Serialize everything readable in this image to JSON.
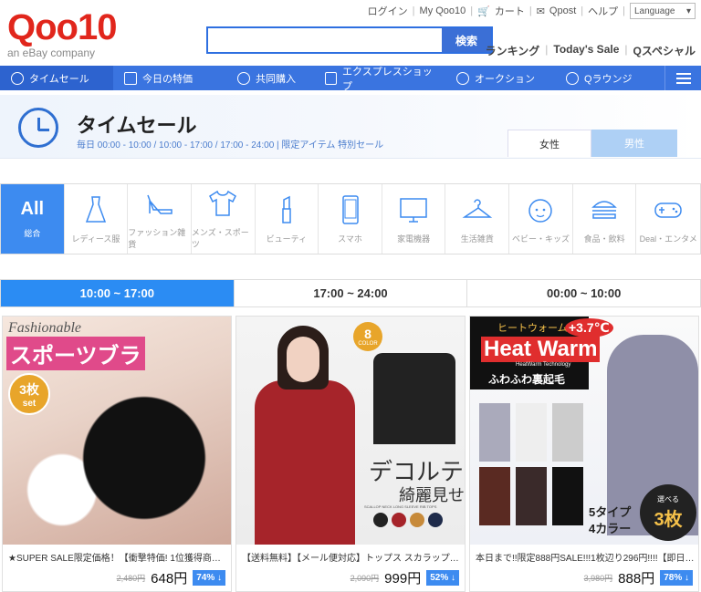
{
  "header": {
    "logo_brand": "Qoo10",
    "logo_sub": "an eBay company",
    "util_links": [
      "ログイン",
      "My Qoo10",
      "カート",
      "Qpost",
      "ヘルプ"
    ],
    "language": "Language",
    "search": {
      "placeholder": "",
      "button": "検索"
    },
    "right_links": [
      "ランキング",
      "Today's Sale",
      "Qスペシャル"
    ]
  },
  "nav": {
    "items": [
      "タイムセール",
      "今日の特価",
      "共同購入",
      "エクスプレスショップ",
      "オークション",
      "Qラウンジ"
    ]
  },
  "hero": {
    "title": "タイムセール",
    "desc": "毎日 00:00 - 10:00 / 10:00 - 17:00 / 17:00 - 24:00 | 限定アイテム 特別セール",
    "gender_tabs": [
      "女性",
      "男性"
    ]
  },
  "categories": [
    {
      "big": "All",
      "label": "総合"
    },
    {
      "label": "レディース服"
    },
    {
      "label": "ファッション雑貨"
    },
    {
      "label": "メンズ・スポーツ"
    },
    {
      "label": "ビューティ"
    },
    {
      "label": "スマホ"
    },
    {
      "label": "家電機器"
    },
    {
      "label": "生活雑貨"
    },
    {
      "label": "ベビー・キッズ"
    },
    {
      "label": "食品・飲料"
    },
    {
      "label": "Deal・エンタメ"
    }
  ],
  "time_tabs": [
    "10:00 ~ 17:00",
    "17:00 ~ 24:00",
    "00:00 ~ 10:00"
  ],
  "products": [
    {
      "name": "★SUPER SALE限定価格！【衝撃特価! 1位獲得商品】...",
      "old_price": "2,480円",
      "price": "648円",
      "discount": "74% ↓",
      "img_text": [
        "Fashionable",
        "スポーツブラ",
        "3枚",
        "set"
      ]
    },
    {
      "name": "【送料無料】【メール便対応】トップス スカラップ リブ 長袖...",
      "old_price": "2,090円",
      "price": "999円",
      "discount": "52% ↓",
      "img_text": [
        "8",
        "COLOR",
        "デコルテ",
        "綺麗見せ",
        "SCALLOP NECK LONG SLEEVE RIB TOPS"
      ]
    },
    {
      "name": "本日まで!!限定888円SALE!!!1枚辺り296円!!!!【即日発...",
      "old_price": "3,980円",
      "price": "888円",
      "discount": "78% ↓",
      "img_text": [
        "ヒートウォーム",
        "+3.7℃",
        "Heat Warm",
        "HeatWarm Technology",
        "ふわふわ裏起毛",
        "5タイプ",
        "4カラー",
        "選べる",
        "3枚"
      ]
    }
  ],
  "colors": {
    "accent": "#3a74e0",
    "time_active": "#2b8cf3",
    "logo": "#e1261c"
  }
}
